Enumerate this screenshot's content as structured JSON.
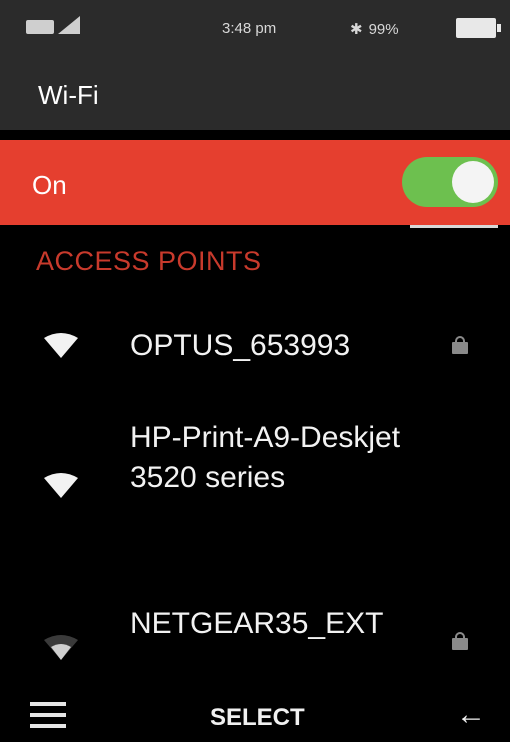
{
  "status_bar": {
    "time": "3:48 pm",
    "battery_text": "99%",
    "icons": [
      "battery-small-icon",
      "signal-icon",
      "bluetooth-icon",
      "battery-icon"
    ]
  },
  "header": {
    "title": "Wi-Fi"
  },
  "wifi_toggle": {
    "label": "On",
    "state": true,
    "accent_color": "#e53f2f",
    "switch_color": "#6dc04f"
  },
  "access_points": {
    "heading": "ACCESS POINTS",
    "heading_color": "#c83a2c",
    "items": [
      {
        "name": "OPTUS_653993",
        "secured": true
      },
      {
        "name": "HP-Print-A9-Deskjet 3520 series",
        "secured": false
      },
      {
        "name": "NETGEAR35_EXT",
        "secured": true
      }
    ]
  },
  "bottom_bar": {
    "select_label": "SELECT",
    "icons": [
      "menu-icon",
      "back-arrow-icon"
    ]
  }
}
